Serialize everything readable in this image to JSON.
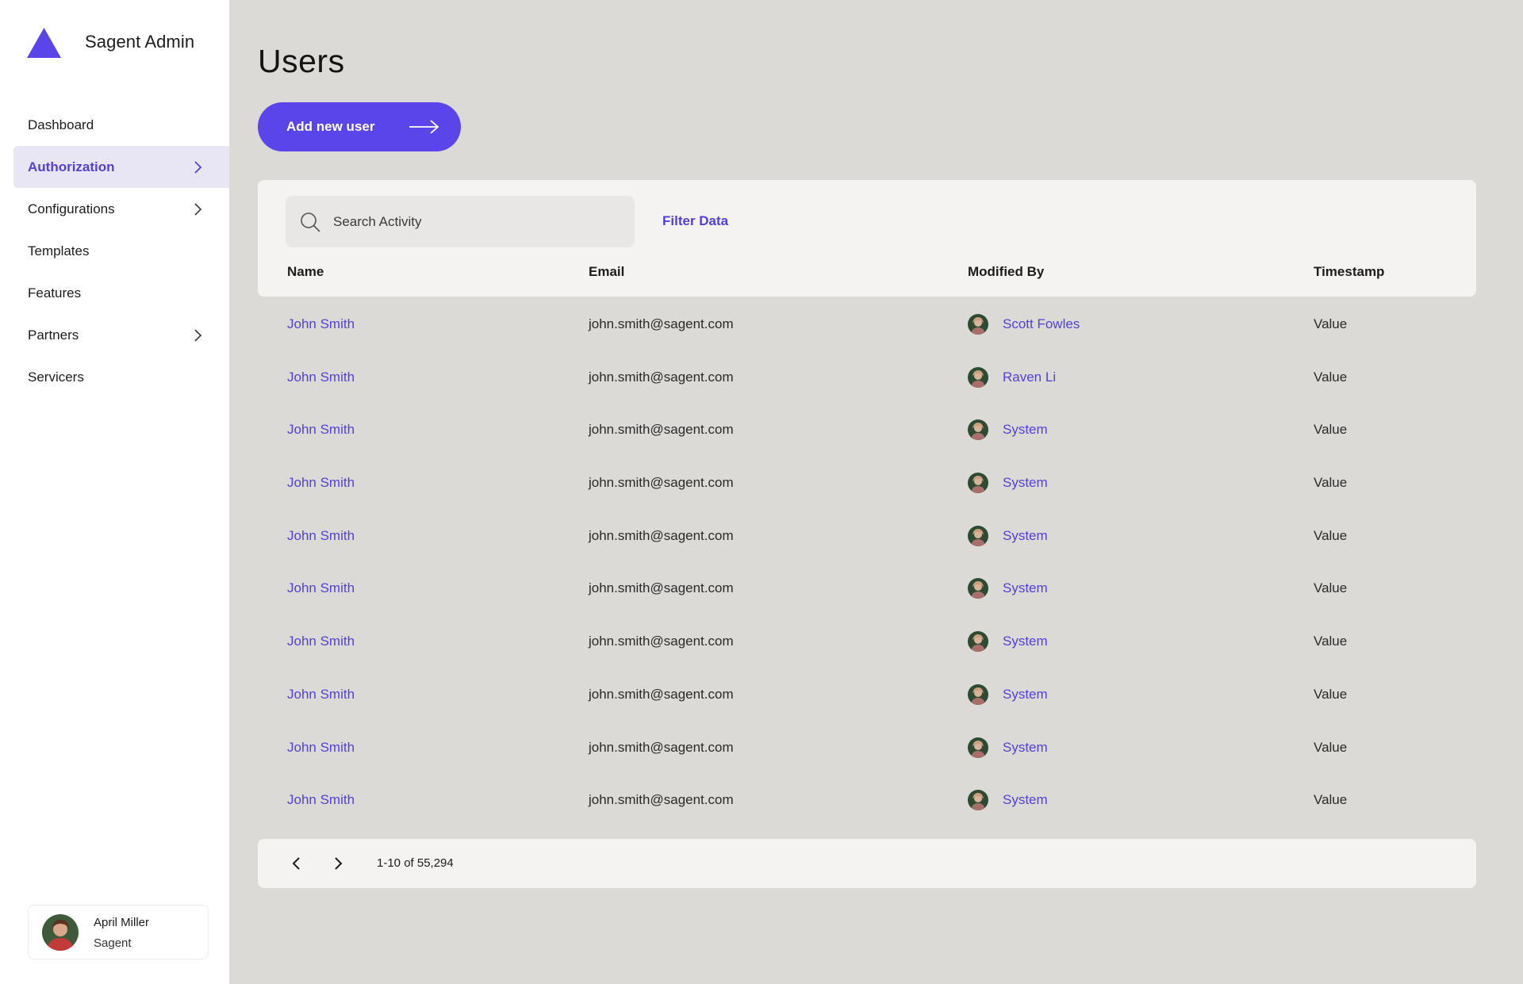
{
  "app": {
    "name": "Sagent Admin",
    "accent_color": "#5a45ea"
  },
  "sidebar": {
    "items": [
      {
        "label": "Dashboard",
        "has_chevron": false,
        "active": false
      },
      {
        "label": "Authorization",
        "has_chevron": true,
        "active": true
      },
      {
        "label": "Configurations",
        "has_chevron": true,
        "active": false
      },
      {
        "label": "Templates",
        "has_chevron": false,
        "active": false
      },
      {
        "label": "Features",
        "has_chevron": false,
        "active": false
      },
      {
        "label": "Partners",
        "has_chevron": true,
        "active": false
      },
      {
        "label": "Servicers",
        "has_chevron": false,
        "active": false
      }
    ],
    "user": {
      "name": "April Miller",
      "org": "Sagent"
    }
  },
  "main": {
    "title": "Users",
    "add_button_label": "Add new user",
    "search_placeholder": "Search Activity",
    "filter_label": "Filter Data",
    "columns": [
      "Name",
      "Email",
      "Modified By",
      "Timestamp"
    ],
    "rows": [
      {
        "name": "John Smith",
        "email": "john.smith@sagent.com",
        "modified_by": "Scott Fowles",
        "timestamp": "Value"
      },
      {
        "name": "John Smith",
        "email": "john.smith@sagent.com",
        "modified_by": "Raven Li",
        "timestamp": "Value"
      },
      {
        "name": "John Smith",
        "email": "john.smith@sagent.com",
        "modified_by": "System",
        "timestamp": "Value"
      },
      {
        "name": "John Smith",
        "email": "john.smith@sagent.com",
        "modified_by": "System",
        "timestamp": "Value"
      },
      {
        "name": "John Smith",
        "email": "john.smith@sagent.com",
        "modified_by": "System",
        "timestamp": "Value"
      },
      {
        "name": "John Smith",
        "email": "john.smith@sagent.com",
        "modified_by": "System",
        "timestamp": "Value"
      },
      {
        "name": "John Smith",
        "email": "john.smith@sagent.com",
        "modified_by": "System",
        "timestamp": "Value"
      },
      {
        "name": "John Smith",
        "email": "john.smith@sagent.com",
        "modified_by": "System",
        "timestamp": "Value"
      },
      {
        "name": "John Smith",
        "email": "john.smith@sagent.com",
        "modified_by": "System",
        "timestamp": "Value"
      },
      {
        "name": "John Smith",
        "email": "john.smith@sagent.com",
        "modified_by": "System",
        "timestamp": "Value"
      }
    ],
    "pagination": {
      "range_text": "1-10 of 55,294"
    }
  },
  "icons": {
    "logo": "triangle-logo-icon",
    "chevron": "chevron-right-icon",
    "arrow": "arrow-right-icon",
    "search": "search-icon",
    "prev": "chevron-left-icon",
    "next": "chevron-right-icon"
  }
}
